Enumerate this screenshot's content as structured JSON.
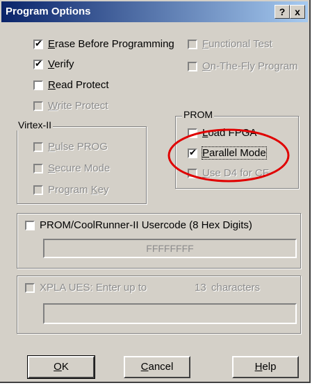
{
  "window": {
    "title": "Program Options",
    "help_icon": "?",
    "close_icon": "x"
  },
  "options": {
    "erase": {
      "pre": "",
      "u": "E",
      "post": "rase Before Programming",
      "checked": true
    },
    "verify": {
      "pre": "",
      "u": "V",
      "post": "erify",
      "checked": true
    },
    "read_protect": {
      "pre": "",
      "u": "R",
      "post": "ead Protect",
      "checked": false
    },
    "write_protect": {
      "pre": "",
      "u": "W",
      "post": "rite Protect",
      "checked": false
    },
    "functional_test": {
      "pre": "",
      "u": "F",
      "post": "unctional Test",
      "checked": false
    },
    "on_the_fly": {
      "pre": "",
      "u": "O",
      "post": "n-The-Fly Program",
      "checked": false
    }
  },
  "virtex": {
    "label": "Virtex-II",
    "pulse_prog": {
      "pre": "",
      "u": "P",
      "post": "ulse PROG"
    },
    "secure_mode": {
      "pre": "",
      "u": "S",
      "post": "ecure Mode"
    },
    "program_key": {
      "pre": "Program ",
      "u": "K",
      "post": "ey"
    }
  },
  "prom": {
    "label": "PROM",
    "load_fpga": {
      "pre": "",
      "u": "L",
      "post": "oad FPGA",
      "checked": false
    },
    "parallel_mode": {
      "pre": "",
      "u": "P",
      "post": "arallel Mode",
      "checked": true
    },
    "use_d4": {
      "pre": "",
      "u": "U",
      "post": "se D4 for CF",
      "checked": false
    }
  },
  "usercode": {
    "label": "PROM/CoolRunner-II Usercode (8 Hex Digits)",
    "value": "FFFFFFFF"
  },
  "xpla": {
    "label": "XPLA UES: Enter up to",
    "count": "13",
    "suffix": "characters",
    "value": ""
  },
  "buttons": {
    "ok": {
      "u": "O",
      "post": "K"
    },
    "cancel": {
      "u": "C",
      "post": "ancel"
    },
    "help": {
      "u": "H",
      "post": "elp"
    }
  },
  "colors": {
    "annotation": "#e00000",
    "title_start": "#0a246a",
    "title_end": "#a6caf0"
  }
}
